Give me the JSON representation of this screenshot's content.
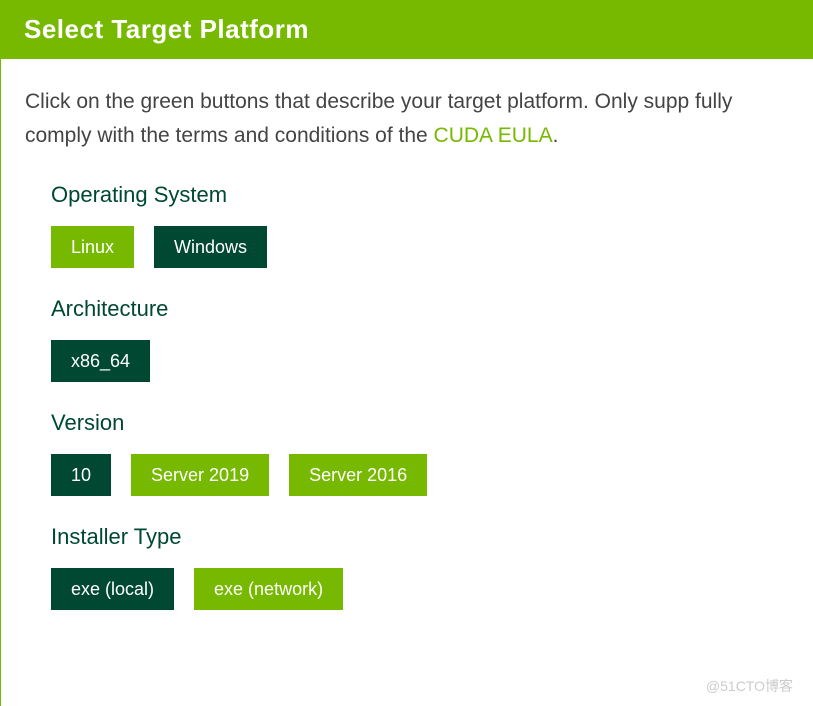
{
  "header": {
    "title": "Select Target Platform"
  },
  "intro": {
    "text_before_link": "Click on the green buttons that describe your target platform. Only supp fully comply with the terms and conditions of the ",
    "link_text": "CUDA EULA",
    "text_after_link": "."
  },
  "sections": {
    "os": {
      "label": "Operating System",
      "options": [
        {
          "label": "Linux",
          "variant": "light"
        },
        {
          "label": "Windows",
          "variant": "dark"
        }
      ]
    },
    "arch": {
      "label": "Architecture",
      "options": [
        {
          "label": "x86_64",
          "variant": "dark"
        }
      ]
    },
    "version": {
      "label": "Version",
      "options": [
        {
          "label": "10",
          "variant": "dark"
        },
        {
          "label": "Server 2019",
          "variant": "light"
        },
        {
          "label": "Server 2016",
          "variant": "light"
        }
      ]
    },
    "installer": {
      "label": "Installer Type",
      "options": [
        {
          "label": "exe (local)",
          "variant": "dark"
        },
        {
          "label": "exe (network)",
          "variant": "light"
        }
      ]
    }
  },
  "watermark": "@51CTO博客"
}
